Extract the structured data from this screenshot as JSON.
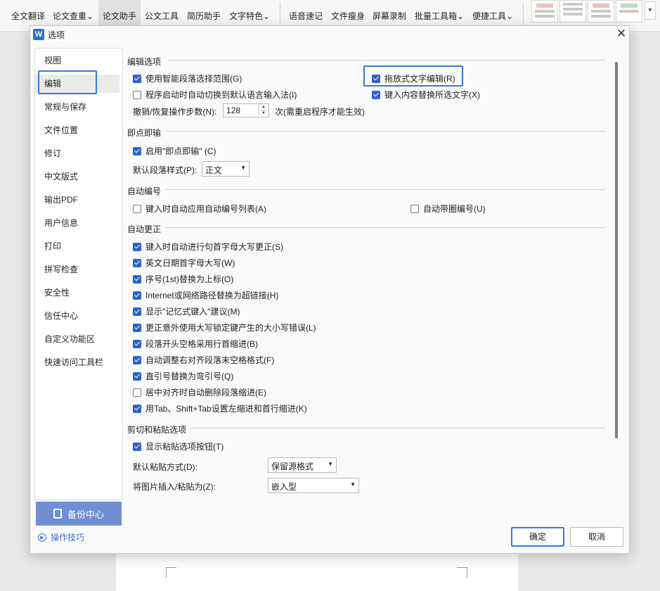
{
  "ribbon": {
    "items": [
      {
        "label": "全文翻译"
      },
      {
        "label": "论文查重",
        "dropdown": true
      },
      {
        "label": "论文助手",
        "active": true
      },
      {
        "label": "公文工具"
      },
      {
        "label": "简历助手"
      },
      {
        "label": "文字特色",
        "dropdown": true
      },
      {
        "label": "语音速记"
      },
      {
        "label": "文件瘦身"
      },
      {
        "label": "屏幕录制"
      },
      {
        "label": "批量工具箱",
        "dropdown": true
      },
      {
        "label": "便捷工具",
        "dropdown": true
      }
    ],
    "dropdown_glyph": "⌄",
    "more_glyph": "▾"
  },
  "dialog": {
    "logo": "W",
    "title": "选项",
    "close_glyph": "✕",
    "nav": [
      {
        "label": "视图"
      },
      {
        "label": "编辑",
        "active": true
      },
      {
        "label": "常规与保存"
      },
      {
        "label": "文件位置"
      },
      {
        "label": "修订"
      },
      {
        "label": "中文版式"
      },
      {
        "label": "输出PDF"
      },
      {
        "label": "用户信息"
      },
      {
        "label": "打印"
      },
      {
        "label": "拼写检查"
      },
      {
        "label": "安全性"
      },
      {
        "label": "信任中心"
      },
      {
        "label": "自定义功能区"
      },
      {
        "label": "快速访问工具栏"
      }
    ],
    "backup_label": "备份中心",
    "tips_label": "操作技巧",
    "ok_label": "确定",
    "cancel_label": "取消",
    "sections": {
      "edit": {
        "title": "编辑选项",
        "opt_smart_para": {
          "label": "使用智能段落选择范围(G)",
          "checked": true
        },
        "opt_drag_edit": {
          "label": "拖放式文字编辑(R)",
          "checked": true
        },
        "opt_auto_ime": {
          "label": "程序启动时自动切换到默认语言输入法(I)",
          "checked": false
        },
        "opt_replace_sel": {
          "label": "键入内容替换所选文字(X)",
          "checked": true
        },
        "undo_label": "撤销/恢复操作步数(N):",
        "undo_value": "128",
        "undo_hint": "次(需重启程序才能生效)"
      },
      "clicktype": {
        "title": "即点即输",
        "opt_enable": {
          "label": "启用\"即点即输\" (C)",
          "checked": true
        },
        "style_label": "默认段落样式(P):",
        "style_value": "正文"
      },
      "autonum": {
        "title": "自动编号",
        "opt_auto_list": {
          "label": "键入时自动应用自动编号列表(A)",
          "checked": false
        },
        "opt_circle_num": {
          "label": "自动带圈编号(U)",
          "checked": false
        }
      },
      "autocorrect": {
        "title": "自动更正",
        "items": [
          {
            "label": "键入时自动进行句首字母大写更正(S)",
            "checked": true
          },
          {
            "label": "英文日期首字母大写(W)",
            "checked": true
          },
          {
            "label": "序号(1st)替换为上标(O)",
            "checked": true
          },
          {
            "label": "Internet或网络路径替换为超链接(H)",
            "checked": true
          },
          {
            "label": "显示\"记忆式键入\"建议(M)",
            "checked": true
          },
          {
            "label": "更正意外使用大写锁定键产生的大小写错误(L)",
            "checked": true
          },
          {
            "label": "段落开头空格采用行首缩进(B)",
            "checked": true
          },
          {
            "label": "自动调整右对齐段落末空格格式(F)",
            "checked": true
          },
          {
            "label": "直引号替换为弯引号(Q)",
            "checked": true
          },
          {
            "label": "居中对齐时自动删除段落缩进(E)",
            "checked": false
          },
          {
            "label": "用Tab、Shift+Tab设置左缩进和首行缩进(K)",
            "checked": true
          }
        ]
      },
      "paste": {
        "title": "剪切和粘贴选项",
        "opt_show_btn": {
          "label": "显示粘贴选项按钮(T)",
          "checked": true
        },
        "default_label": "默认粘贴方式(D):",
        "default_value": "保留源格式",
        "image_label": "将图片插入/粘贴为(Z):",
        "image_value": "嵌入型"
      }
    },
    "select_arrow": "▼",
    "spin_up": "▲",
    "spin_down": "▼"
  }
}
